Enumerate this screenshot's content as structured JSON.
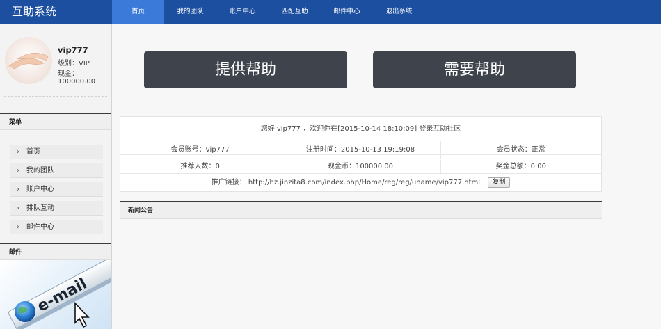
{
  "header": {
    "brand": "互助系统",
    "nav": [
      "首页",
      "我的团队",
      "账户中心",
      "匹配互助",
      "邮件中心",
      "退出系统"
    ]
  },
  "profile": {
    "username": "vip777",
    "level": "级别：VIP",
    "cash_label": "现金：",
    "cash_value": "100000.00"
  },
  "sidebar": {
    "menu_title": "菜单",
    "items": [
      "首页",
      "我的团队",
      "账户中心",
      "排队互动",
      "邮件中心"
    ],
    "mail_title": "邮件",
    "mail_banner_text": "e-mail"
  },
  "actions": {
    "provide": "提供帮助",
    "need": "需要帮助"
  },
  "info": {
    "welcome": "您好 vip777 ，欢迎你在[2015-10-14 18:10:09] 登录互助社区",
    "row1": [
      "会员账号：vip777",
      "注册时间：2015-10-13 19:19:08",
      "会员状态：正常"
    ],
    "row2": [
      "推荐人数：0",
      "现金币：100000.00",
      "奖金总额：0.00"
    ],
    "promo_label": "推广链接：",
    "promo_url": "http://hz.jinzita8.com/index.php/Home/reg/reg/uname/vip777.html",
    "copy_label": "复制"
  },
  "news": {
    "title": "新闻公告"
  }
}
